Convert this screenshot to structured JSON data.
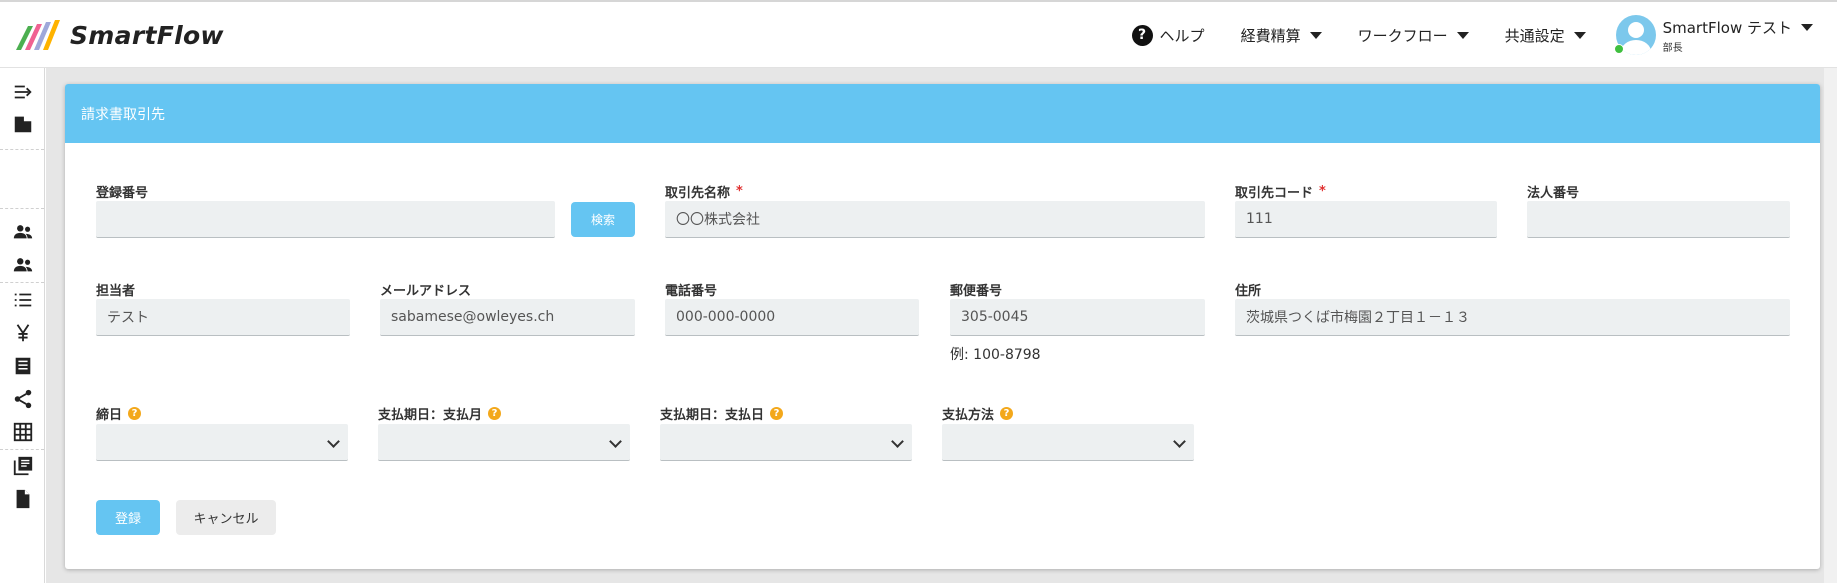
{
  "app": {
    "logo_text": "SmartFlow"
  },
  "nav": {
    "help": "ヘルプ",
    "expense": "経費精算",
    "workflow": "ワークフロー",
    "common_settings": "共通設定",
    "user_name": "SmartFlow テスト",
    "user_role": "部長"
  },
  "card": {
    "title": "請求書取引先"
  },
  "form": {
    "registration_number": {
      "label": "登録番号",
      "value": ""
    },
    "search_button": "検索",
    "partner_name": {
      "label": "取引先名称",
      "required_mark": "*",
      "value": "〇〇株式会社"
    },
    "partner_code": {
      "label": "取引先コード",
      "required_mark": "*",
      "value": "111"
    },
    "corporate_number": {
      "label": "法人番号",
      "value": ""
    },
    "contact_person": {
      "label": "担当者",
      "value": "テスト"
    },
    "email": {
      "label": "メールアドレス",
      "value": "sabamese@owleyes.ch"
    },
    "phone": {
      "label": "電話番号",
      "value": "000-000-0000"
    },
    "postal_code": {
      "label": "郵便番号",
      "value": "305-0045",
      "example": "例: 100-8798"
    },
    "address": {
      "label": "住所",
      "value": "茨城県つくば市梅園２丁目１－１３"
    },
    "closing_day": {
      "label": "締日",
      "hint": "?",
      "value": ""
    },
    "payment_month": {
      "label": "支払期日：支払月",
      "hint": "?",
      "value": ""
    },
    "payment_day": {
      "label": "支払期日：支払日",
      "hint": "?",
      "value": ""
    },
    "payment_method": {
      "label": "支払方法",
      "hint": "?",
      "value": ""
    },
    "submit_button": "登録",
    "cancel_button": "キャンセル"
  },
  "colors": {
    "accent": "#65c5f2",
    "required": "#e03030",
    "hint": "#f3a81b",
    "online": "#3fbf3f"
  }
}
